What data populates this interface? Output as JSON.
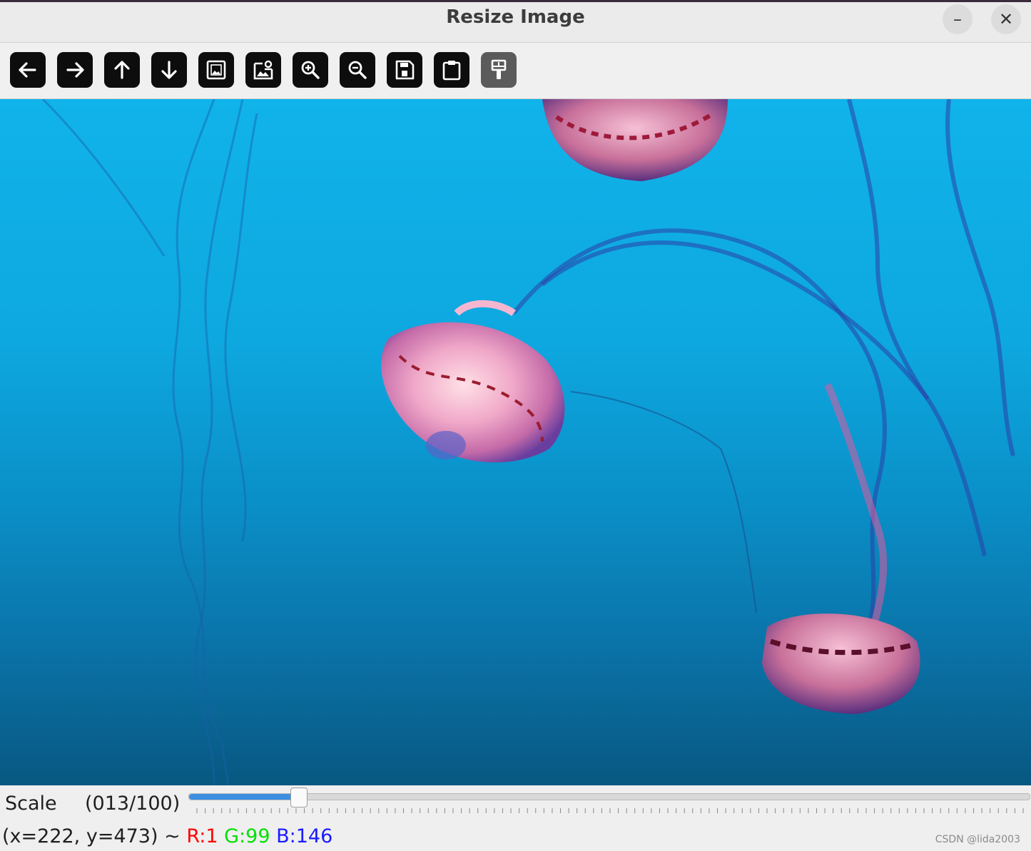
{
  "window": {
    "title": "Resize Image"
  },
  "toolbar": {
    "buttons": [
      {
        "icon": "arrow-left-icon"
      },
      {
        "icon": "arrow-right-icon"
      },
      {
        "icon": "arrow-up-icon"
      },
      {
        "icon": "arrow-down-icon"
      },
      {
        "icon": "image-icon"
      },
      {
        "icon": "image-properties-icon"
      },
      {
        "icon": "zoom-in-icon"
      },
      {
        "icon": "zoom-out-icon"
      },
      {
        "icon": "save-icon"
      },
      {
        "icon": "clipboard-icon"
      },
      {
        "icon": "paint-brush-icon",
        "disabled": true
      }
    ]
  },
  "trackbar": {
    "label": "Scale",
    "value_text": "(013/100)",
    "value": 13,
    "max": 100,
    "fill_color": "#3d8fe0"
  },
  "status": {
    "coords": "(x=222, y=473) ~",
    "r": "R:1",
    "g": "G:99",
    "b": "B:146",
    "r_color": "#ff0000",
    "g_color": "#00e000",
    "b_color": "#1a1aff"
  },
  "watermark": "CSDN @lida2003"
}
